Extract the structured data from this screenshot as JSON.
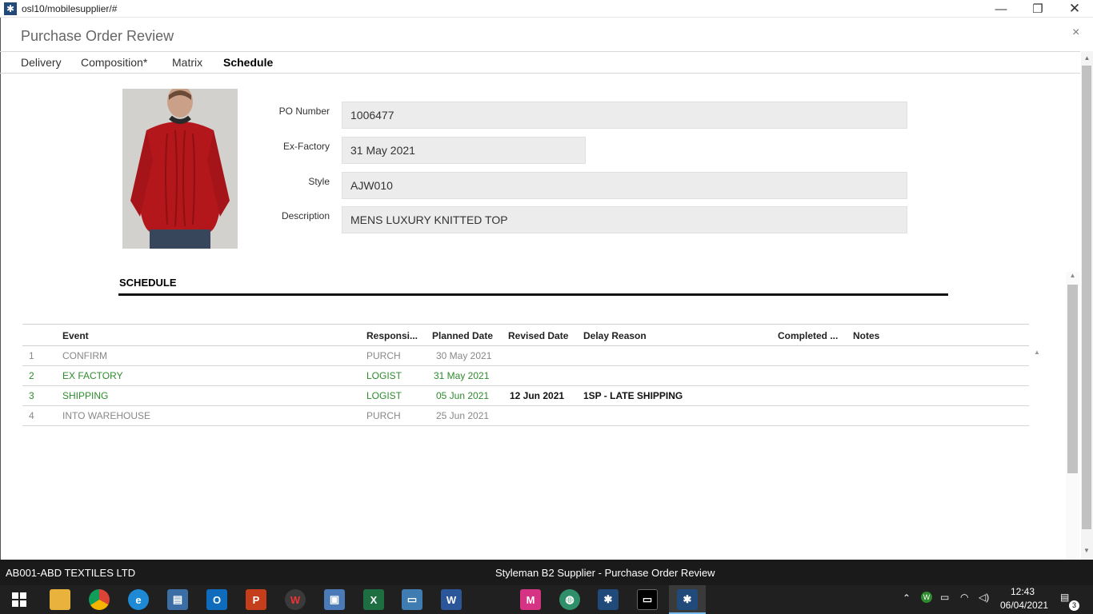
{
  "window": {
    "title": "osl10/mobilesupplier/#",
    "minimize_glyph": "—",
    "restore_glyph": "❐",
    "close_glyph": "✕"
  },
  "dialog": {
    "title": "Purchase Order Review",
    "close_glyph": "×",
    "tabs": [
      "Delivery",
      "Composition*",
      "Matrix",
      "Schedule"
    ],
    "active_tab": "Schedule"
  },
  "fields": {
    "po_number_label": "PO Number",
    "po_number": "1006477",
    "ex_factory_label": "Ex-Factory",
    "ex_factory": "31 May 2021",
    "style_label": "Style",
    "style": "AJW010",
    "description_label": "Description",
    "description": "MENS LUXURY KNITTED TOP"
  },
  "schedule": {
    "section_title": "SCHEDULE",
    "columns": {
      "event": "Event",
      "responsible": "Responsi...",
      "planned": "Planned Date",
      "revised": "Revised Date",
      "delay": "Delay Reason",
      "completed": "Completed ...",
      "notes": "Notes"
    },
    "rows": [
      {
        "num": "1",
        "event": "CONFIRM",
        "responsible": "PURCH",
        "planned": "30 May 2021",
        "revised": "",
        "delay": "",
        "status": "grey"
      },
      {
        "num": "2",
        "event": "EX FACTORY",
        "responsible": "LOGIST",
        "planned": "31 May 2021",
        "revised": "",
        "delay": "",
        "status": "green"
      },
      {
        "num": "3",
        "event": "SHIPPING",
        "responsible": "LOGIST",
        "planned": "05 Jun 2021",
        "revised": "12 Jun 2021",
        "delay": "1SP - LATE SHIPPING",
        "status": "green"
      },
      {
        "num": "4",
        "event": "INTO WAREHOUSE",
        "responsible": "PURCH",
        "planned": "25 Jun 2021",
        "revised": "",
        "delay": "",
        "status": "grey"
      }
    ]
  },
  "statusbar": {
    "company": "AB001-ABD TEXTILES LTD",
    "app_title": "Styleman B2 Supplier - Purchase Order Review"
  },
  "taskbar": {
    "time": "12:43",
    "date": "06/04/2021",
    "notification_count": "3",
    "colors": {
      "outlook": "#0f6cbd",
      "powerpoint": "#c43e1c",
      "excel": "#1d6f42",
      "word": "#2b579a",
      "active_app": "#1f4a7a"
    }
  }
}
